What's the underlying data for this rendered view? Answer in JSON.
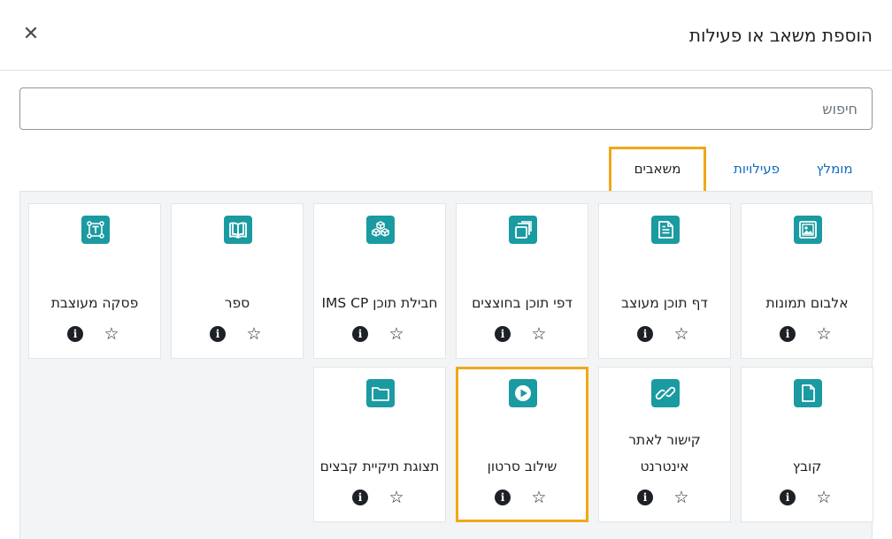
{
  "modal": {
    "title": "הוספת משאב או פעילות",
    "close_icon": "close-icon"
  },
  "search": {
    "placeholder": "חיפוש",
    "value": ""
  },
  "tabs": [
    {
      "label": "מומלץ",
      "active": false
    },
    {
      "label": "פעילויות",
      "active": false
    },
    {
      "label": "משאבים",
      "active": true
    }
  ],
  "colors": {
    "icon_bg": "#1a9aa1",
    "highlight": "#f0a818",
    "tab_link": "#0f6cbf"
  },
  "modules": [
    {
      "label": "אלבום תמונות",
      "icon": "image-gallery-icon"
    },
    {
      "label": "דף תוכן מעוצב",
      "icon": "page-icon"
    },
    {
      "label": "דפי תוכן בחוצצים",
      "icon": "tabbed-pages-icon"
    },
    {
      "label": "חבילת תוכן IMS CP",
      "icon": "ims-package-icon"
    },
    {
      "label": "ספר",
      "icon": "book-icon"
    },
    {
      "label": "פסקה מעוצבת",
      "icon": "text-media-area-icon"
    },
    {
      "label": "קובץ",
      "icon": "file-icon"
    },
    {
      "label": "קישור לאתר אינטרנט",
      "icon": "link-icon"
    },
    {
      "label": "שילוב סרטון",
      "icon": "video-play-icon"
    },
    {
      "label": "תצוגת תיקיית קבצים",
      "icon": "folder-icon"
    }
  ],
  "card_actions": {
    "info_glyph": "i",
    "star_glyph": "☆"
  }
}
